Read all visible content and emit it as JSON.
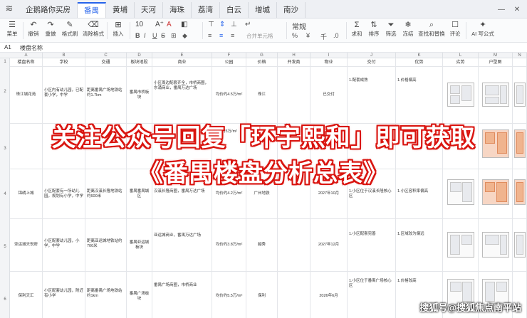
{
  "tabbar": {
    "app_icon": "layers-icon",
    "tabs": [
      "企鹅路你买房",
      "番禺",
      "黄埔",
      "天河",
      "海珠",
      "荔湾",
      "白云",
      "增城",
      "南沙"
    ],
    "active_tab": "番禺"
  },
  "toolbar": {
    "menu": "菜单",
    "undo": "撤销",
    "redo": "重做",
    "format_painter": "格式刷",
    "clear_format": "清除格式",
    "insert": "插入",
    "font_size": "10",
    "number_format": "常规",
    "merge": "合并单元格",
    "percent": "%",
    "currency": "¥",
    "thousands": "千",
    "sum": "求和",
    "sort": "排序",
    "filter": "筛选",
    "freeze": "冻结",
    "find_replace": "查找和替换",
    "comment": "评论",
    "ai_formula": "AI 写公式"
  },
  "formula_bar": {
    "cell_ref": "A1",
    "content": "楼盘名称"
  },
  "sheet": {
    "columns": [
      "A",
      "B",
      "C",
      "D",
      "E",
      "F",
      "G",
      "H",
      "I",
      "J",
      "K",
      "L",
      "M",
      "N"
    ],
    "header_row": [
      "楼盘名称",
      "学校",
      "交通",
      "板块地段",
      "商业",
      "公园",
      "价格",
      "开发商",
      "物业",
      "交付",
      "优势",
      "劣势",
      "户型图",
      ""
    ],
    "row_numbers": [
      "1",
      "2",
      "3",
      "4",
      "5",
      "6"
    ],
    "rows": [
      {
        "name": "珠江城花苑",
        "school": "小区内有幼儿园，已配套小学，中学",
        "transport": "距离番禺广场地铁站约1.7km",
        "area": "番禺市桥板块",
        "business": "小区周边配套齐全，市桥商圈，东涌商业，番禺万达广场",
        "park": "",
        "price": "均价约4.5万/m²",
        "developer": "珠江",
        "property": "",
        "delivery": "已交付",
        "pros": "1.配套成熟",
        "cons": "1.价格偏高"
      },
      {
        "name": "",
        "school": "",
        "transport": "",
        "area": "",
        "business": "",
        "park": "",
        "price": "均价约5万/m²",
        "developer": "",
        "property": "",
        "delivery": "",
        "pros": "",
        "cons": ""
      },
      {
        "name": "锦绣上城",
        "school": "小区配套有一所幼儿园，规划有小学，中学",
        "transport": "距离汉溪长隆地铁站约600米",
        "area": "番禺番禺城区",
        "business": "汉溪长隆商圈，番禺万达广场",
        "park": "",
        "price": "均价约4.2万/m²",
        "developer": "广州地铁",
        "property": "",
        "delivery": "2027年10月",
        "pros": "1.小区位于汉溪长隆核心区",
        "cons": "1.小区容积率偏高"
      },
      {
        "name": "亚运城天悦府",
        "school": "小区配套幼儿园，小学，中学",
        "transport": "距离亚运城地铁站约700米",
        "area": "番禺亚运城板块",
        "business": "亚运城商业，番禺万达广场",
        "park": "",
        "price": "均价约3.8万/m²",
        "developer": "越秀",
        "property": "",
        "delivery": "2027年12月",
        "pros": "1.小区配套完善",
        "cons": "1.区域较为偏远"
      },
      {
        "name": "保利天汇",
        "school": "小区配套幼儿园，附近有小学",
        "transport": "距离番禺广场地铁站约1km",
        "area": "番禺广场板块",
        "business": "番禺广场商圈，市桥商业",
        "park": "",
        "price": "均价约5.5万/m²",
        "developer": "保利",
        "property": "",
        "delivery": "2026年6月",
        "pros": "1.小区位于番禺广场核心区",
        "cons": "1.价格较高"
      }
    ]
  },
  "overlay": {
    "line1": "关注公众号回复「环宇熙和」即可获取",
    "line2": "《番禺楼盘分析总表》",
    "watermark": "搜狐号@搜狐焦点南平站"
  },
  "colors": {
    "accent": "#2563eb",
    "banner_red": "#d9140f",
    "floorplan_orange": "#f0b48e"
  }
}
